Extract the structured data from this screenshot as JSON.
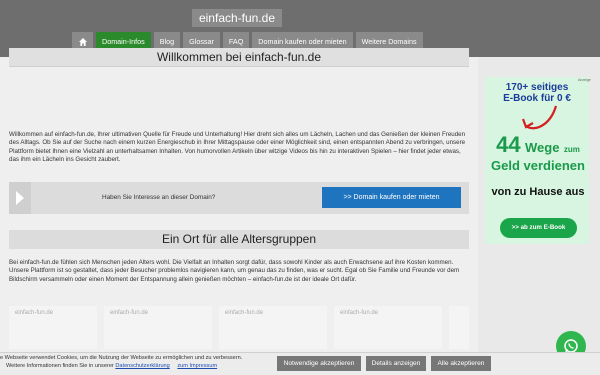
{
  "header": {
    "site_title": "einfach-fun.de",
    "nav": {
      "home_icon": "home-icon",
      "items": [
        {
          "label": "Domain-Infos",
          "active": true
        },
        {
          "label": "Blog"
        },
        {
          "label": "Glossar"
        },
        {
          "label": "FAQ"
        },
        {
          "label": "Domain kaufen oder mieten"
        },
        {
          "label": "Weitere Domains"
        }
      ]
    }
  },
  "main": {
    "welcome_title": "Willkommen bei einfach-fun.de",
    "welcome_text": "Willkommen auf einfach-fun.de, Ihrer ultimativen Quelle für Freude und Unterhaltung! Hier dreht sich alles um Lächeln, Lachen und das Genießen der kleinen Freuden des Alltags. Ob Sie auf der Suche nach einem kurzen Energieschub in Ihrer Mittagspause oder einer Möglichkeit sind, einen entspannten Abend zu verbringen, unsere Plattform bietet Ihnen eine Vielzahl an unterhaltsamen Inhalten. Von humorvollen Artikeln über witzige Videos bis hin zu interaktiven Spielen – hier findet jeder etwas, das ihm ein Lächeln ins Gesicht zaubert.",
    "cta": {
      "arrow_icon": "chevron-right-icon",
      "question": "Haben Sie Interesse an dieser Domain?",
      "button": ">> Domain kaufen oder mieten"
    },
    "section2_title": "Ein Ort für alle Altersgruppen",
    "section2_text": "Bei einfach-fun.de fühlen sich Menschen jeden Alters wohl. Die Vielfalt an Inhalten sorgt dafür, dass sowohl Kinder als auch Erwachsene auf ihre Kosten kommen. Unsere Plattform ist so gestaltet, dass jeder Besucher problemlos navigieren kann, um genau das zu finden, was er sucht. Egal ob Sie Familie und Freunde vor dem Bildschirm versammeln oder einen Moment der Entspannung allein genießen möchten – einfach-fun.de ist der ideale Ort dafür.",
    "thumb_label": "einfach-fun.de"
  },
  "ad": {
    "tag": "Anzeige",
    "ebook_line1": "170+ seitiges",
    "ebook_line2": "E-Book für 0 €",
    "line_44": "44",
    "line_wege": "Wege",
    "line_zum": "zum",
    "line_geld": "Geld verdienen",
    "line_home": "von zu Hause aus",
    "button": ">> ab zum E-Book"
  },
  "whatsapp": {
    "icon": "whatsapp-icon"
  },
  "cookie": {
    "text_line1": "e Webseite verwendet Cookies, um die Nutzung der Webseite zu ermöglichen und zu verbessern.",
    "text_line2_prefix": "Weitere Informationen finden Sie in unserer",
    "privacy_link": "Datenschutzerklärung",
    "imprint_link": "zum Impressum",
    "btn_necessary": "Notwendige akzeptieren",
    "btn_details": "Details anzeigen",
    "btn_all": "Alle akzeptieren"
  },
  "colors": {
    "header_bg": "#6e6e6e",
    "nav_active": "#2b8a2b",
    "cta_button": "#1e74bf",
    "ad_green": "#1aa54a"
  }
}
